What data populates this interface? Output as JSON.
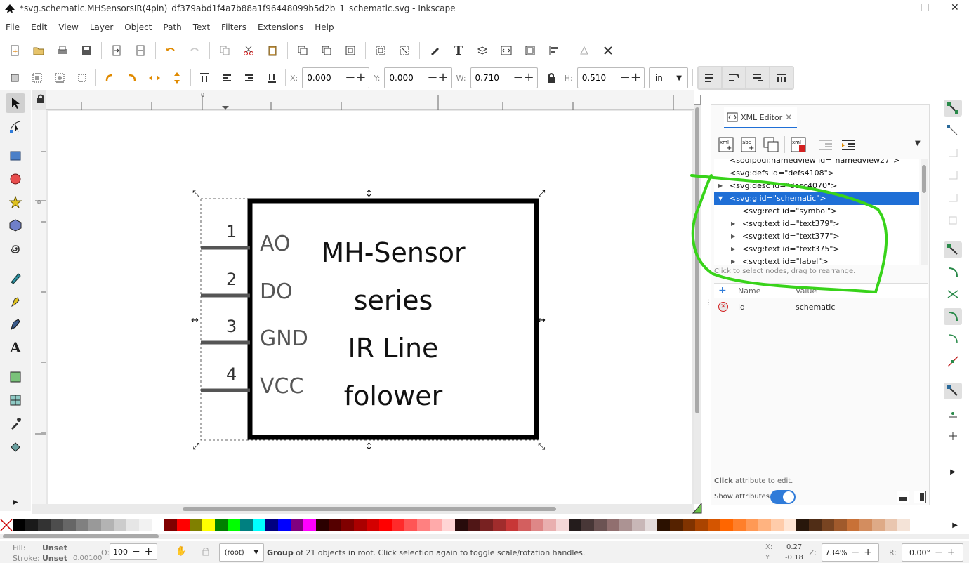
{
  "window": {
    "title": "*svg.schematic.MHSensorsIR(4pin)_df379abd1f4a7b88a1f96448099b5d2b_1_schematic.svg - Inkscape",
    "min": "—",
    "max": "☐",
    "close": "✕"
  },
  "menu": [
    "File",
    "Edit",
    "View",
    "Layer",
    "Object",
    "Path",
    "Text",
    "Filters",
    "Extensions",
    "Help"
  ],
  "toolctrl": {
    "x_label": "X:",
    "x_value": "0.000",
    "y_label": "Y:",
    "y_value": "0.000",
    "w_label": "W:",
    "w_value": "0.710",
    "h_label": "H:",
    "h_value": "0.510",
    "unit": "in"
  },
  "ruler": {
    "h_zero": "0",
    "v_zero": "0"
  },
  "schematic": {
    "pins": [
      {
        "num": "1",
        "name": "AO"
      },
      {
        "num": "2",
        "name": "DO"
      },
      {
        "num": "3",
        "name": "GND"
      },
      {
        "num": "4",
        "name": "VCC"
      }
    ],
    "label_lines": [
      "MH-Sensor",
      "series",
      "IR Line",
      "folower"
    ]
  },
  "xml_editor": {
    "tab_label": "XML Editor",
    "nodes": [
      {
        "text": "<sodipodi:namedview id=\"namedview27\">",
        "indent": 0,
        "selected": false,
        "arrow": ""
      },
      {
        "text": "<svg:defs id=\"defs4108\">",
        "indent": 0,
        "selected": false,
        "arrow": ""
      },
      {
        "text": "<svg:desc id=\"desc4070\">",
        "indent": 0,
        "selected": false,
        "arrow": "▶"
      },
      {
        "text": "<svg:g id=\"schematic\">",
        "indent": 0,
        "selected": true,
        "arrow": "▼"
      },
      {
        "text": "<svg:rect id=\"symbol\">",
        "indent": 1,
        "selected": false,
        "arrow": ""
      },
      {
        "text": "<svg:text id=\"text379\">",
        "indent": 1,
        "selected": false,
        "arrow": "▶"
      },
      {
        "text": "<svg:text id=\"text377\">",
        "indent": 1,
        "selected": false,
        "arrow": "▶"
      },
      {
        "text": "<svg:text id=\"text375\">",
        "indent": 1,
        "selected": false,
        "arrow": "▶"
      },
      {
        "text": "<svg:text id=\"label\">",
        "indent": 1,
        "selected": false,
        "arrow": "▶"
      }
    ],
    "hint": "Click to select nodes, drag to rearrange.",
    "attr_header_name": "Name",
    "attr_header_value": "Value",
    "attributes": [
      {
        "name": "id",
        "value": "schematic"
      }
    ],
    "click_hint_bold": "Click",
    "click_hint_rest": " attribute to edit.",
    "show_attributes": "Show attributes"
  },
  "status": {
    "fill_label": "Fill:",
    "fill_value": "Unset",
    "stroke_label": "Stroke:",
    "stroke_value": "Unset",
    "stroke_width": "0.00100",
    "opacity_label": "O:",
    "opacity_value": "100",
    "layer": "(root)",
    "message_bold": "Group",
    "message_rest": " of 21 objects in root. Click selection again to toggle scale/rotation handles.",
    "x_label": "X:",
    "x_value": "0.27",
    "y_label": "Y:",
    "y_value": "-0.18",
    "z_label": "Z:",
    "zoom": "734%",
    "r_label": "R:",
    "rotation": "0.00°"
  },
  "colors": {
    "selection": "#1f6fd6",
    "annotation": "#38d31a",
    "toggle": "#2f7bd9"
  },
  "palette": [
    "#000000",
    "#1a1a1a",
    "#333333",
    "#4d4d4d",
    "#666666",
    "#808080",
    "#999999",
    "#b3b3b3",
    "#cccccc",
    "#e6e6e6",
    "#f2f2f2",
    "#ffffff",
    "#800000",
    "#ff0000",
    "#808000",
    "#ffff00",
    "#008000",
    "#00ff00",
    "#008080",
    "#00ffff",
    "#000080",
    "#0000ff",
    "#800080",
    "#ff00ff",
    "#2b0000",
    "#550000",
    "#800000",
    "#aa0000",
    "#d40000",
    "#ff0000",
    "#ff2a2a",
    "#ff5555",
    "#ff8080",
    "#ffaaaa",
    "#ffd5d5",
    "#280b0b",
    "#501616",
    "#782121",
    "#a02c2c",
    "#c83737",
    "#d35f5f",
    "#de8787",
    "#e9afaf",
    "#f4d7d7",
    "#241c1c",
    "#483737",
    "#6c5353",
    "#916f6f",
    "#ac9393",
    "#c8b7b7",
    "#e3dbdb",
    "#2b1100",
    "#552200",
    "#803300",
    "#aa4400",
    "#d45500",
    "#ff6600",
    "#ff7f2a",
    "#ff9955",
    "#ffb380",
    "#ffccaa",
    "#ffe6d5",
    "#28170b",
    "#502d16",
    "#784421",
    "#a05a2c",
    "#c87137",
    "#d38d5f",
    "#deaa87",
    "#e9c6af",
    "#f4e3d7"
  ]
}
